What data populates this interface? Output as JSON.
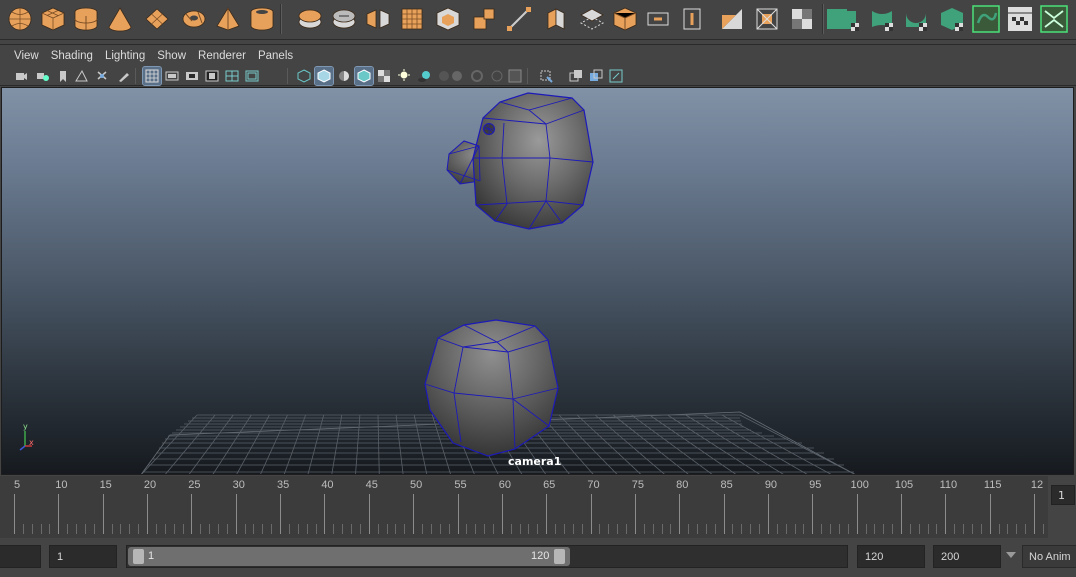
{
  "shelf": {
    "icons": [
      "poly-sphere-icon",
      "poly-cube-icon",
      "poly-cylinder-icon",
      "poly-cone-icon",
      "poly-plane-icon",
      "poly-torus-icon",
      "poly-pyramid-icon",
      "poly-pipe-icon",
      "combine-icon",
      "separate-icon",
      "mirror-icon",
      "smooth-icon",
      "extrude-icon",
      "bevel-icon",
      "bridge-icon",
      "multi-cut-icon",
      "insert-edge-loop-icon",
      "append-polygon-icon",
      "fill-hole-icon",
      "poly-cube-shell-icon",
      "uv-layout-icon",
      "uv-bounding-icon",
      "uv-snapshot-icon",
      "uv-select-icon",
      "uv-checker-icon",
      "uv-planar-icon",
      "uv-cylindrical-icon",
      "uv-spherical-icon",
      "uv-automatic-icon",
      "uv-unfold-icon",
      "uv-editor-icon",
      "uv-symmetry-icon"
    ]
  },
  "menubar": {
    "items": [
      "View",
      "Shading",
      "Lighting",
      "Show",
      "Renderer",
      "Panels"
    ]
  },
  "panel_toolbar": {
    "icons": [
      "select-camera-icon",
      "camera-attributes-icon",
      "bookmark-icon",
      "image-plane-icon",
      "camera-tools-icon",
      "grease-pencil-icon",
      "grid-icon",
      "film-gate-icon",
      "resolution-gate-icon",
      "gate-mask-icon",
      "field-chart-icon",
      "safe-action-icon",
      "wireframe-icon",
      "smooth-shade-icon",
      "wireframe-on-shaded-icon",
      "shaded-wireframe-icon",
      "textured-icon",
      "lights-icon",
      "shadows-icon",
      "ambient-occlusion-icon",
      "motion-blur-icon",
      "antialias-icon",
      "depth-of-field-icon",
      "isolate-select-icon",
      "xray-icon",
      "xray-joints-icon",
      "xray-components-icon",
      "display-layers-icon"
    ]
  },
  "viewport": {
    "camera_label": "camera1",
    "axis": {
      "y": "y",
      "x": "x"
    },
    "wireframe_color": "#1d1ab8",
    "background_top": "#8191a6",
    "background_bottom": "#161a1f",
    "grid_color": "#5a6068"
  },
  "timeline": {
    "tick_labels": [
      "5",
      "10",
      "15",
      "20",
      "25",
      "30",
      "35",
      "40",
      "45",
      "50",
      "55",
      "60",
      "65",
      "70",
      "75",
      "80",
      "85",
      "90",
      "95",
      "100",
      "105",
      "110",
      "115",
      "12"
    ],
    "current_frame": "1"
  },
  "range": {
    "start_value": "1",
    "range_start": "1",
    "range_end": "120",
    "end_value": "120",
    "max_value": "200",
    "anim_layer": "No Anim"
  },
  "colors": {
    "shelf_orange": "#e8a15b",
    "shelf_green": "#3fa27a",
    "panel_bg": "#444444",
    "active_toggle": "#5a7089"
  }
}
